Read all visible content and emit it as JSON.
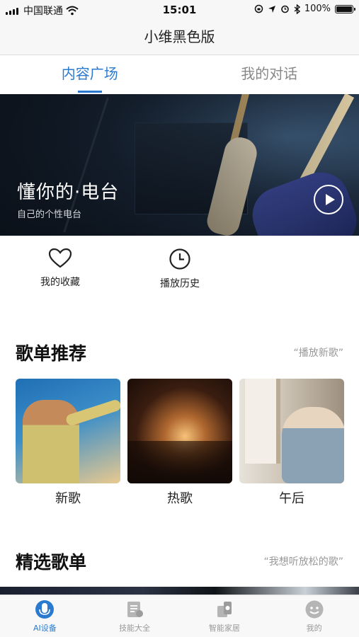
{
  "status_bar": {
    "carrier": "中国联通",
    "time": "15:01",
    "battery": "100%",
    "battery_level": 1.0
  },
  "nav": {
    "title": "小维黑色版"
  },
  "tabs": [
    {
      "label": "内容广场",
      "active": true
    },
    {
      "label": "我的对话",
      "active": false
    }
  ],
  "banner": {
    "title": "懂你的·电台",
    "subtitle": "自己的个性电台",
    "icon": "play-icon"
  },
  "quick_actions": [
    {
      "label": "我的收藏",
      "icon": "heart-icon"
    },
    {
      "label": "播放历史",
      "icon": "clock-icon"
    }
  ],
  "playlist_recommend": {
    "title": "歌单推荐",
    "more": "“播放新歌”",
    "items": [
      {
        "label": "新歌"
      },
      {
        "label": "热歌"
      },
      {
        "label": "午后"
      }
    ]
  },
  "featured": {
    "title": "精选歌单",
    "more": "“我想听放松的歌”"
  },
  "tabbar": [
    {
      "label": "AI设备",
      "icon": "microphone-icon",
      "active": true
    },
    {
      "label": "技能大全",
      "icon": "skills-icon",
      "active": false
    },
    {
      "label": "智能家居",
      "icon": "smart-home-icon",
      "active": false
    },
    {
      "label": "我的",
      "icon": "profile-icon",
      "active": false
    }
  ],
  "colors": {
    "accent": "#2a7bd0",
    "inactive": "#999999"
  }
}
